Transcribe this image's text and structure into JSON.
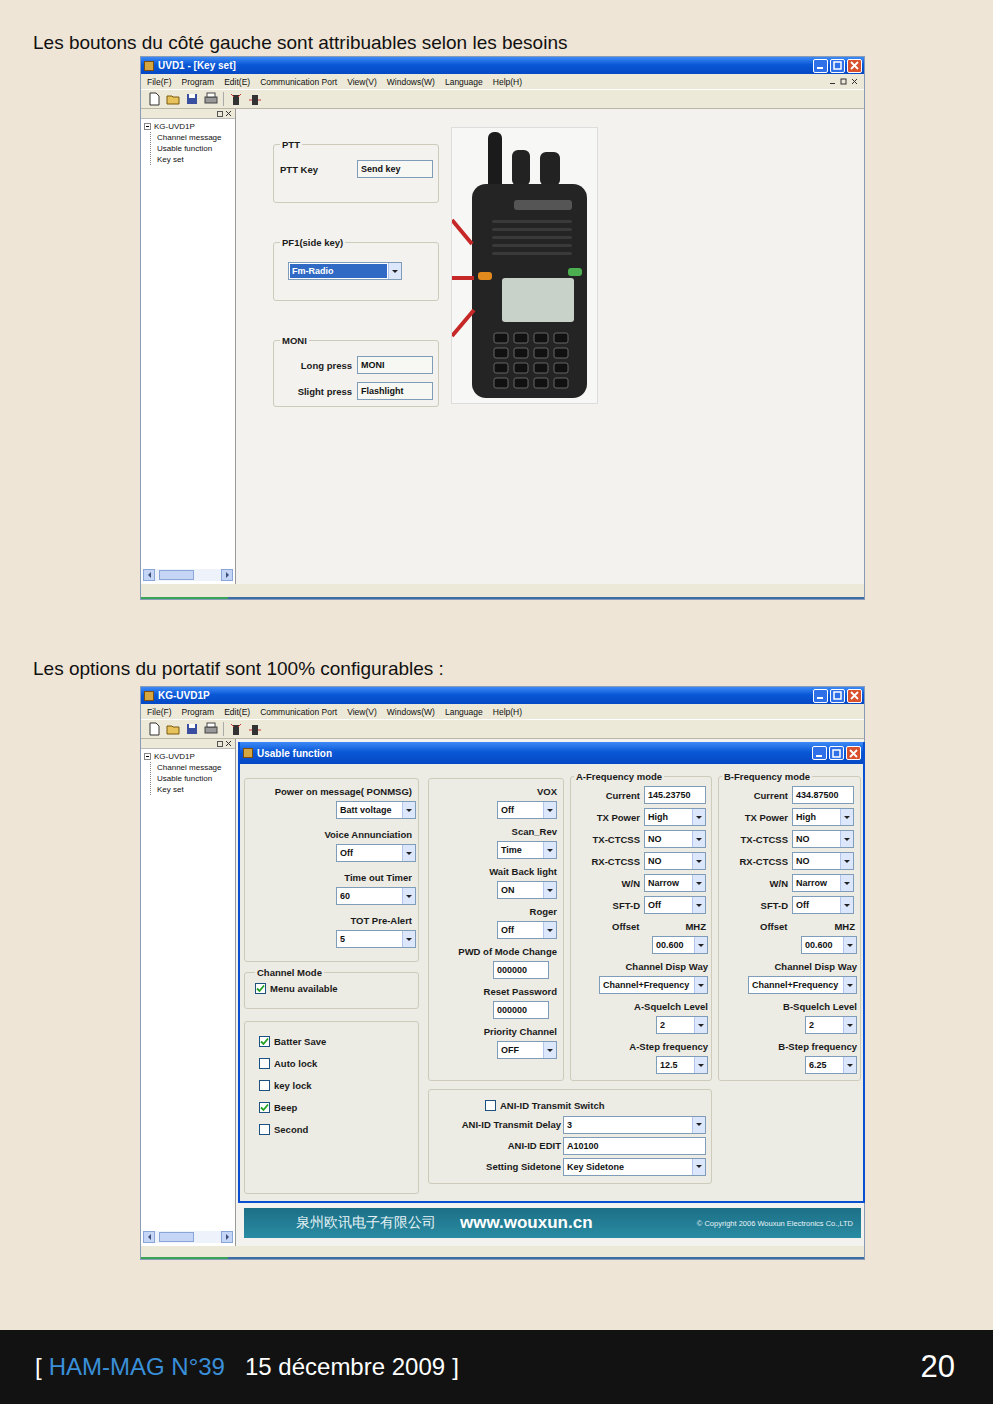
{
  "key_set_figure": {
    "caption": "Les boutons du côté gauche sont attribuables selon les besoins",
    "window": {
      "title": "UVD1 - [Key set]",
      "menu": [
        "File(F)",
        "Program",
        "Edit(E)",
        "Communication Port",
        "View(V)",
        "Windows(W)",
        "Language",
        "Help(H)"
      ],
      "tree": {
        "root": "KG-UVD1P",
        "expanded": true,
        "items": [
          {
            "label": "Channel message",
            "selected": false
          },
          {
            "label": "Usable function",
            "selected": false
          },
          {
            "label": "Key set",
            "selected": false
          }
        ]
      },
      "groups": [
        {
          "title": "PTT",
          "kind": "fields",
          "rows": [
            {
              "label": "PTT Key",
              "value": "Send key"
            }
          ]
        },
        {
          "title": "PF1(side key)",
          "kind": "select",
          "value": "Fm-Radio",
          "focused": true
        },
        {
          "title": "MONI",
          "kind": "fields",
          "rows": [
            {
              "label": "Long press",
              "value": "MONI"
            },
            {
              "label": "Slight press",
              "value": "Flashlight"
            }
          ]
        }
      ]
    }
  },
  "usable_figure": {
    "caption": "Les options du portatif sont 100% configurables :",
    "window": {
      "title": "KG-UVD1P",
      "menu": [
        "File(F)",
        "Program",
        "Edit(E)",
        "Communication Port",
        "View(V)",
        "Windows(W)",
        "Language",
        "Help(H)"
      ],
      "tree": {
        "root": "KG-UVD1P",
        "expanded": true,
        "items": [
          {
            "label": "Channel message",
            "selected": false
          },
          {
            "label": "Usable function",
            "selected": false
          },
          {
            "label": "Key set",
            "selected": false
          }
        ]
      }
    },
    "panel": {
      "title": "Usable function",
      "general": [
        {
          "label": "Power on message( PONMSG)",
          "value": "Batt voltage"
        },
        {
          "label": "Voice Annunciation",
          "value": "Off"
        },
        {
          "label": "Time out Timer",
          "value": "60"
        },
        {
          "label": "TOT Pre-Alert",
          "value": "5"
        }
      ],
      "channel_mode": {
        "title": "Channel Mode",
        "option": {
          "label": "Menu available",
          "checked": true
        }
      },
      "toggles": [
        {
          "label": "Batter Save",
          "checked": true
        },
        {
          "label": "Auto lock",
          "checked": false
        },
        {
          "label": "key lock",
          "checked": false
        },
        {
          "label": "Beep",
          "checked": true
        },
        {
          "label": "Second",
          "checked": false
        }
      ],
      "misc": [
        {
          "label": "VOX",
          "value": "Off",
          "kind": "select"
        },
        {
          "label": "Scan_Rev",
          "value": "Time",
          "kind": "select"
        },
        {
          "label": "Wait Back light",
          "value": "ON",
          "kind": "select"
        },
        {
          "label": "Roger",
          "value": "Off",
          "kind": "select"
        },
        {
          "label": "PWD of Mode Change",
          "value": "000000",
          "kind": "text"
        },
        {
          "label": "Reset Password",
          "value": "000000",
          "kind": "text"
        },
        {
          "label": "Priority Channel",
          "value": "OFF",
          "kind": "select"
        }
      ],
      "bands": [
        {
          "title": "A-Frequency mode",
          "inline": [
            {
              "label": "Current",
              "value": "145.23750",
              "kind": "text"
            },
            {
              "label": "TX Power",
              "value": "High",
              "kind": "select"
            },
            {
              "label": "TX-CTCSS",
              "value": "NO",
              "kind": "select"
            },
            {
              "label": "RX-CTCSS",
              "value": "NO",
              "kind": "select"
            },
            {
              "label": "W/N",
              "value": "Narrow",
              "kind": "select"
            },
            {
              "label": "SFT-D",
              "value": "Off",
              "kind": "select"
            }
          ],
          "offset": {
            "label": "Offset",
            "unit": "MHZ",
            "value": "00.600"
          },
          "display": {
            "label": "Channel Disp Way",
            "value": "Channel+Frequency"
          },
          "squelch": {
            "label": "A-Squelch Level",
            "value": "2"
          },
          "step": {
            "label": "A-Step frequency",
            "value": "12.5"
          }
        },
        {
          "title": "B-Frequency mode",
          "inline": [
            {
              "label": "Current",
              "value": "434.87500",
              "kind": "text"
            },
            {
              "label": "TX Power",
              "value": "High",
              "kind": "select"
            },
            {
              "label": "TX-CTCSS",
              "value": "NO",
              "kind": "select"
            },
            {
              "label": "RX-CTCSS",
              "value": "NO",
              "kind": "select"
            },
            {
              "label": "W/N",
              "value": "Narrow",
              "kind": "select"
            },
            {
              "label": "SFT-D",
              "value": "Off",
              "kind": "select"
            }
          ],
          "offset": {
            "label": "Offset",
            "unit": "MHZ",
            "value": "00.600"
          },
          "display": {
            "label": "Channel Disp Way",
            "value": "Channel+Frequency"
          },
          "squelch": {
            "label": "B-Squelch Level",
            "value": "2"
          },
          "step": {
            "label": "B-Step frequency",
            "value": "6.25"
          }
        }
      ],
      "ani": {
        "switch": {
          "label": "ANI-ID Transmit Switch",
          "checked": false
        },
        "rows": [
          {
            "label": "ANI-ID Transmit Delay",
            "value": "3",
            "kind": "select"
          },
          {
            "label": "ANI-ID EDIT",
            "value": "A10100",
            "kind": "text"
          },
          {
            "label": "Setting Sidetone",
            "value": "Key Sidetone",
            "kind": "select"
          }
        ]
      }
    },
    "banner": {
      "company": "泉州欧讯电子有限公司",
      "url": "www.wouxun.cn",
      "copyright": "© Copyright 2006 Wouxun Electronics Co.,LTD"
    }
  },
  "footer": {
    "open": "[",
    "magazine": "HAM-MAG N°39",
    "date": "15 décembre 2009",
    "close": "]",
    "page": "20"
  }
}
